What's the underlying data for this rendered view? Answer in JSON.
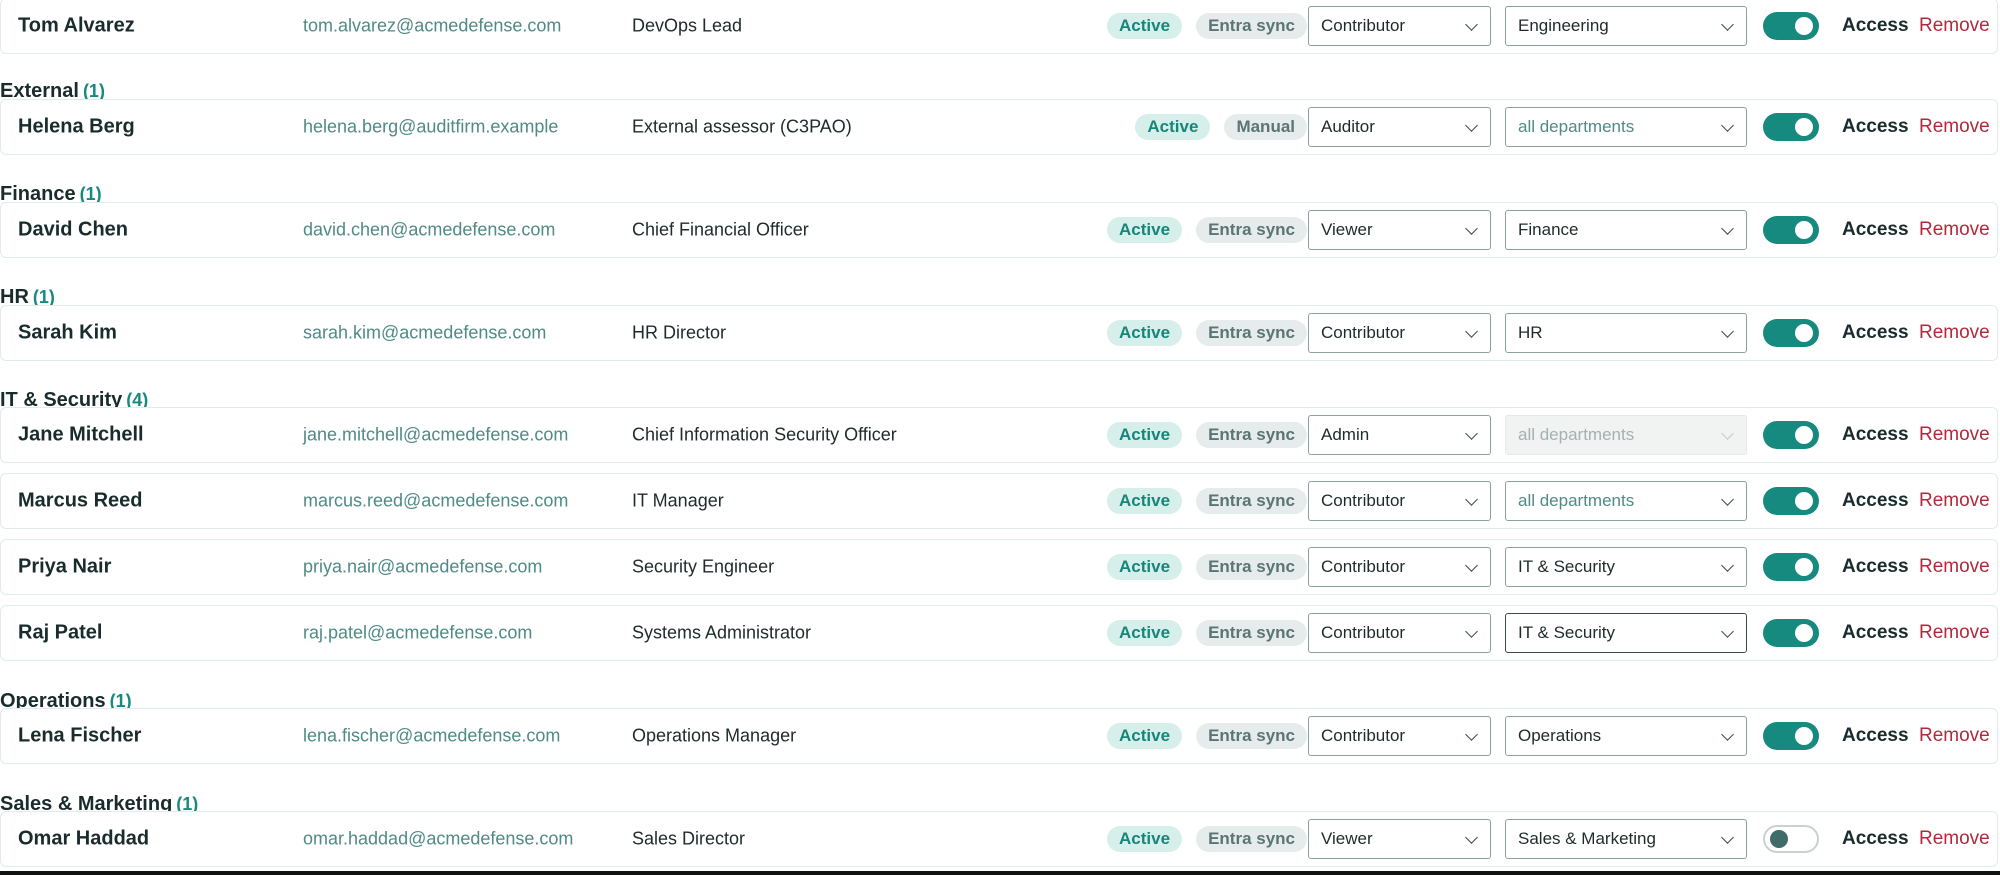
{
  "colors": {
    "accent": "#178a80",
    "remove": "#b2293b",
    "status_badge_bg": "#d7efeb",
    "source_badge_bg": "#e6eceb"
  },
  "row_labels": {
    "access": "Access",
    "remove": "Remove"
  },
  "groups": [
    {
      "name": "",
      "count": "",
      "users": [
        {
          "name": "Tom Alvarez",
          "email": "tom.alvarez@acmedefense.com",
          "title": "DevOps Lead",
          "status": "Active",
          "source": "Entra sync",
          "role": "Contributor",
          "department": "Engineering",
          "access_enabled": true
        }
      ]
    },
    {
      "name": "External",
      "count": "(1)",
      "users": [
        {
          "name": "Helena Berg",
          "email": "helena.berg@auditfirm.example",
          "title": "External assessor (C3PAO)",
          "status": "Active",
          "source": "Manual",
          "role": "Auditor",
          "department": "all departments",
          "access_enabled": true
        }
      ]
    },
    {
      "name": "Finance",
      "count": "(1)",
      "users": [
        {
          "name": "David Chen",
          "email": "david.chen@acmedefense.com",
          "title": "Chief Financial Officer",
          "status": "Active",
          "source": "Entra sync",
          "role": "Viewer",
          "department": "Finance",
          "access_enabled": true
        }
      ]
    },
    {
      "name": "HR",
      "count": "(1)",
      "users": [
        {
          "name": "Sarah Kim",
          "email": "sarah.kim@acmedefense.com",
          "title": "HR Director",
          "status": "Active",
          "source": "Entra sync",
          "role": "Contributor",
          "department": "HR",
          "access_enabled": true
        }
      ]
    },
    {
      "name": "IT & Security",
      "count": "(4)",
      "users": [
        {
          "name": "Jane Mitchell",
          "email": "jane.mitchell@acmedefense.com",
          "title": "Chief Information Security Officer",
          "status": "Active",
          "source": "Entra sync",
          "role": "Admin",
          "department": "all departments",
          "department_disabled": true,
          "access_enabled": true
        },
        {
          "name": "Marcus Reed",
          "email": "marcus.reed@acmedefense.com",
          "title": "IT Manager",
          "status": "Active",
          "source": "Entra sync",
          "role": "Contributor",
          "department": "all departments",
          "access_enabled": true
        },
        {
          "name": "Priya Nair",
          "email": "priya.nair@acmedefense.com",
          "title": "Security Engineer",
          "status": "Active",
          "source": "Entra sync",
          "role": "Contributor",
          "department": "IT & Security",
          "access_enabled": true
        },
        {
          "name": "Raj Patel",
          "email": "raj.patel@acmedefense.com",
          "title": "Systems Administrator",
          "status": "Active",
          "source": "Entra sync",
          "role": "Contributor",
          "department": "IT & Security",
          "department_focused": true,
          "access_enabled": true
        }
      ]
    },
    {
      "name": "Operations",
      "count": "(1)",
      "users": [
        {
          "name": "Lena Fischer",
          "email": "lena.fischer@acmedefense.com",
          "title": "Operations Manager",
          "status": "Active",
          "source": "Entra sync",
          "role": "Contributor",
          "department": "Operations",
          "access_enabled": true
        }
      ]
    },
    {
      "name": "Sales & Marketing",
      "count": "(1)",
      "users": [
        {
          "name": "Omar Haddad",
          "email": "omar.haddad@acmedefense.com",
          "title": "Sales Director",
          "status": "Active",
          "source": "Entra sync",
          "role": "Viewer",
          "department": "Sales & Marketing",
          "access_enabled": false
        }
      ]
    }
  ]
}
